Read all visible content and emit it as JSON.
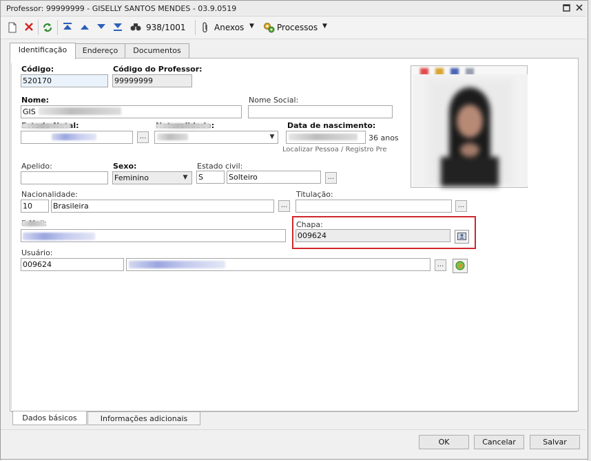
{
  "window": {
    "title": "Professor: 99999999 - GISELLY SANTOS MENDES - 03.9.0519"
  },
  "toolbar": {
    "record_counter": "938/1001",
    "attachments_label": "Anexos",
    "processes_label": "Processos"
  },
  "tabs": [
    {
      "label": "Identificação",
      "active": true
    },
    {
      "label": "Endereço",
      "active": false
    },
    {
      "label": "Documentos",
      "active": false
    }
  ],
  "form": {
    "codigo": {
      "label": "Código:",
      "value": "520170"
    },
    "codigo_professor": {
      "label": "Código do Professor:",
      "value": "99999999"
    },
    "nome": {
      "label": "Nome:",
      "value": "GIS"
    },
    "nome_social": {
      "label": "Nome Social:",
      "value": ""
    },
    "estado_natal": {
      "label": "Estado Natal:"
    },
    "naturalidade": {
      "label": "Naturalidade:"
    },
    "data_nascimento": {
      "label": "Data de nascimento:",
      "age_text": "36 anos"
    },
    "localizar_pessoa": "Localizar Pessoa / Registro Pre",
    "apelido": {
      "label": "Apelido:",
      "value": ""
    },
    "sexo": {
      "label": "Sexo:",
      "value": "Feminino"
    },
    "estado_civil": {
      "label": "Estado civil:",
      "code": "S",
      "value": "Solteiro"
    },
    "nacionalidade": {
      "label": "Nacionalidade:",
      "code": "10",
      "value": "Brasileira"
    },
    "titulacao": {
      "label": "Titulação:",
      "value": ""
    },
    "email": {
      "label": "E-Mail:"
    },
    "chapa": {
      "label": "Chapa:",
      "value": "009624"
    },
    "usuario": {
      "label": "Usuário:",
      "value": "009624"
    }
  },
  "bottom_tabs": [
    {
      "label": "Dados básicos",
      "active": true
    },
    {
      "label": "Informações adicionais",
      "active": false
    }
  ],
  "buttons": {
    "ok": "OK",
    "cancel": "Cancelar",
    "save": "Salvar"
  },
  "colors": {
    "highlight_border": "#d0262b",
    "window_bg": "#f0f0f0",
    "blur_link": "#9aa6e0"
  }
}
